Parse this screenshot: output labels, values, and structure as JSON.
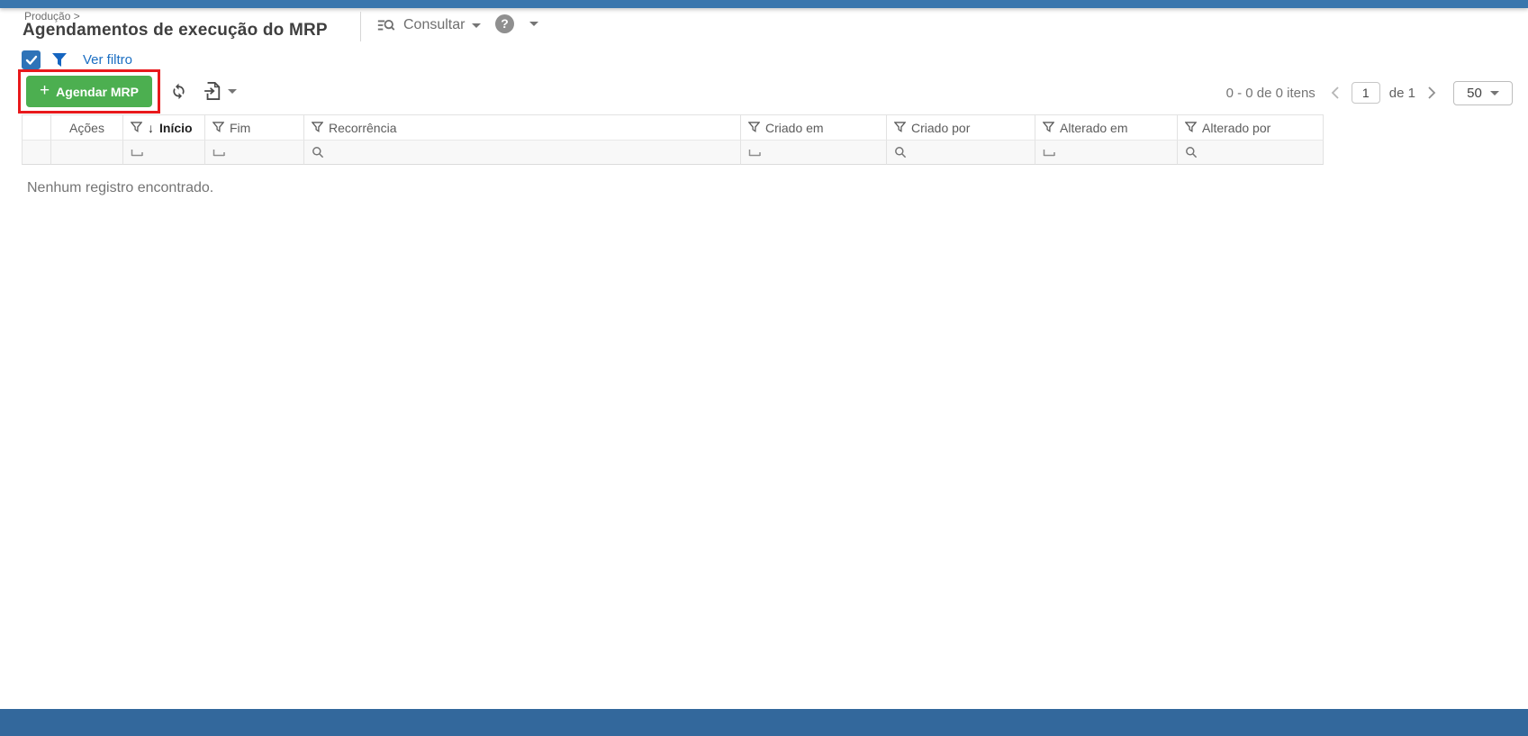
{
  "app": {
    "topbar_color": "#3a76ad",
    "bottombar_color": "#33689c"
  },
  "header": {
    "breadcrumb": "Produção >",
    "title": "Agendamentos de execução do MRP",
    "consultar_label": "Consultar",
    "help_glyph": "?"
  },
  "filterbar": {
    "ver_filtro_label": "Ver filtro"
  },
  "toolbar": {
    "plus_glyph": "+",
    "agendar_label": "Agendar MRP",
    "button_color": "#4caf50",
    "annotation_color": "#e8191c"
  },
  "pagination": {
    "items_text": "0 - 0 de 0 itens",
    "page_value": "1",
    "of_text": "de 1",
    "page_size": "50"
  },
  "table": {
    "columns": [
      {
        "label": ""
      },
      {
        "label": "Ações"
      },
      {
        "label": "Início",
        "sort_glyph": "↓"
      },
      {
        "label": "Fim"
      },
      {
        "label": "Recorrência"
      },
      {
        "label": "Criado em"
      },
      {
        "label": "Criado por"
      },
      {
        "label": "Alterado em"
      },
      {
        "label": "Alterado por"
      }
    ]
  },
  "empty_message": "Nenhum registro encontrado."
}
